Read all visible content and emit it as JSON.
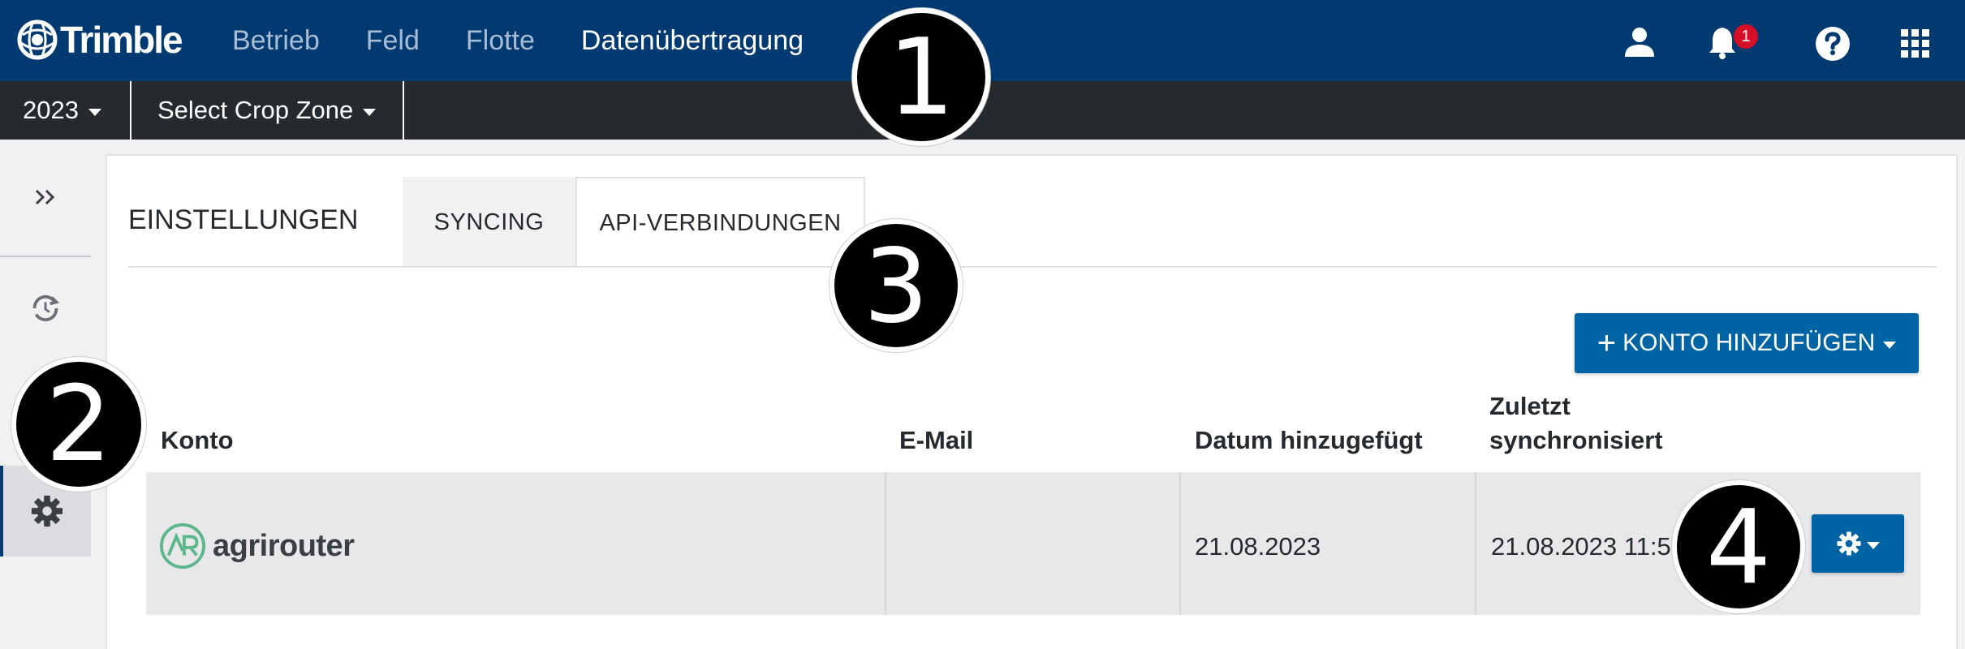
{
  "app": {
    "brand": "Trimble",
    "nav": [
      {
        "label": "Betrieb",
        "active": false
      },
      {
        "label": "Feld",
        "active": false
      },
      {
        "label": "Flotte",
        "active": false
      },
      {
        "label": "Datenübertragung",
        "active": true
      }
    ],
    "notifications_count": "1",
    "icons": [
      "user-icon",
      "bell-icon",
      "help-icon",
      "apps-grid-icon"
    ]
  },
  "subbar": {
    "year": "2023",
    "crop_zone": "Select Crop Zone"
  },
  "sidebar": {
    "items": [
      {
        "icon": "expand-chevrons-icon"
      },
      {
        "icon": "sync-icon"
      },
      {
        "icon": "gear-icon",
        "active": true
      }
    ]
  },
  "tabs": {
    "section_title": "EINSTELLUNGEN",
    "items": [
      {
        "label": "SYNCING",
        "active": false
      },
      {
        "label": "API-VERBINDUNGEN",
        "active": true
      }
    ]
  },
  "add_account_button": "KONTO HINZUFÜGEN",
  "table": {
    "headers": {
      "account": "Konto",
      "email": "E-Mail",
      "date_added": "Datum hinzugefügt",
      "last_synced_line1": "Zuletzt",
      "last_synced_line2": "synchronisiert"
    },
    "rows": [
      {
        "account": "agrirouter",
        "email": "",
        "date_added": "21.08.2023",
        "last_synced": "21.08.2023 11:5"
      }
    ]
  },
  "callouts": [
    "1",
    "2",
    "3",
    "4"
  ],
  "colors": {
    "topbar": "#003a70",
    "subbar": "#252a2e",
    "primary_button": "#0063a3",
    "badge": "#d50f25",
    "agrirouter_green": "#5cb88a"
  }
}
